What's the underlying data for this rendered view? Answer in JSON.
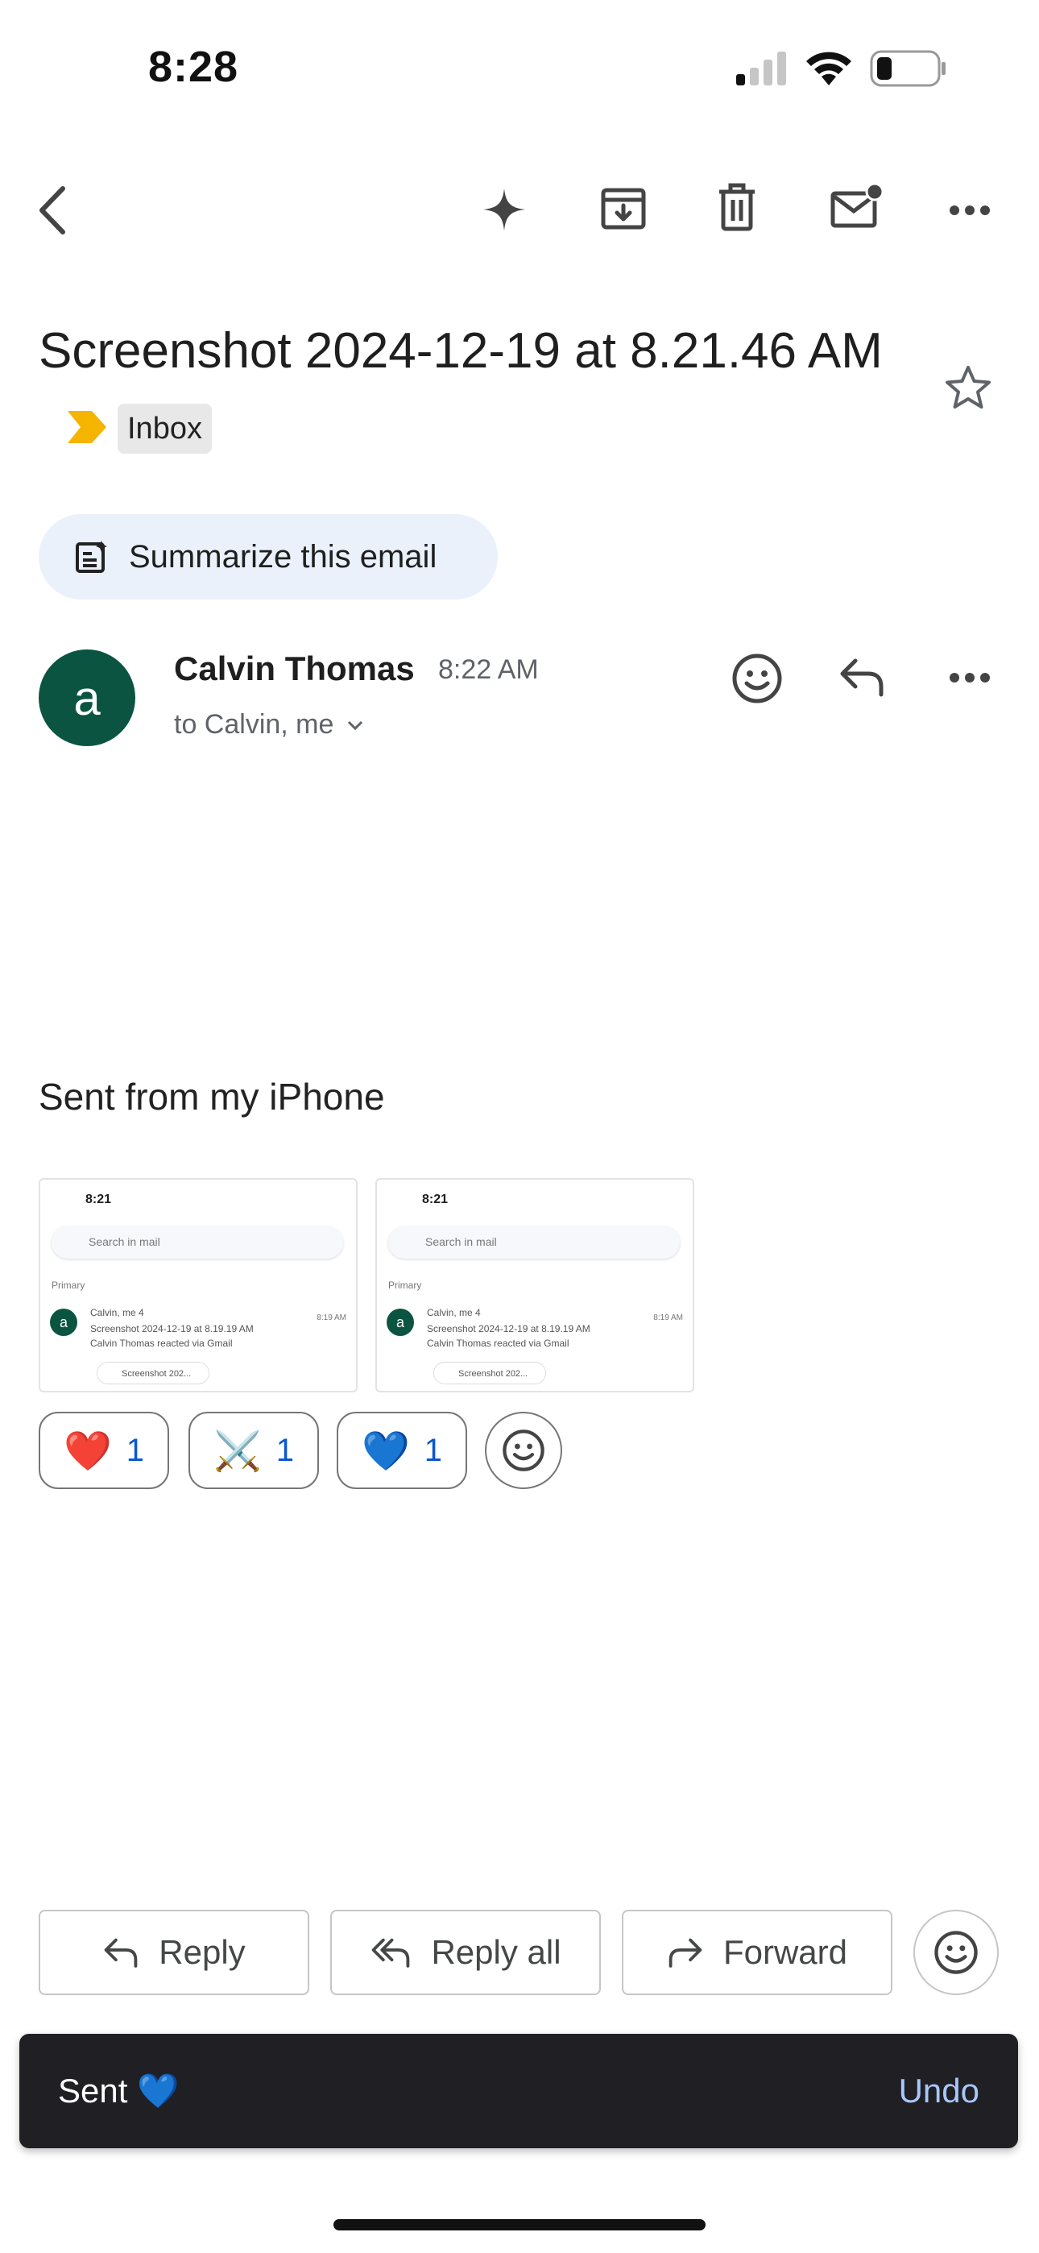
{
  "status_bar": {
    "time": "8:28"
  },
  "toolbar": {
    "icons": [
      "back-icon",
      "sparkle-icon",
      "archive-icon",
      "trash-icon",
      "mark-unread-icon",
      "more-icon"
    ]
  },
  "email": {
    "subject": "Screenshot 2024-12-19 at 8.21.46 AM",
    "label": "Inbox",
    "summarize_label": "Summarize this email",
    "sender": {
      "avatar_letter": "a",
      "name": "Calvin Thomas",
      "time": "8:22 AM",
      "recipients": "to Calvin, me"
    },
    "body": "Sent from my iPhone",
    "thumbnails": [
      {
        "time": "8:21",
        "search_placeholder": "Search in mail",
        "section": "Primary",
        "avatar_letter": "a",
        "from": "Calvin, me 4",
        "received": "8:19 AM",
        "subject": "Screenshot 2024-12-19 at 8.19.19 AM",
        "snippet": "Calvin Thomas reacted via Gmail",
        "attachment": "Screenshot 202..."
      },
      {
        "time": "8:21",
        "search_placeholder": "Search in mail",
        "section": "Primary",
        "avatar_letter": "a",
        "from": "Calvin, me 4",
        "received": "8:19 AM",
        "subject": "Screenshot 2024-12-19 at 8.19.19 AM",
        "snippet": "Calvin Thomas reacted via Gmail",
        "attachment": "Screenshot 202..."
      }
    ],
    "reactions": [
      {
        "emoji": "❤️",
        "count": "1"
      },
      {
        "emoji": "⚔️",
        "count": "1"
      },
      {
        "emoji": "💙",
        "count": "1"
      }
    ]
  },
  "actions": {
    "reply": "Reply",
    "reply_all": "Reply all",
    "forward": "Forward"
  },
  "snackbar": {
    "message": "Sent 💙",
    "undo": "Undo"
  },
  "colors": {
    "accent": "#0b57d0",
    "avatar": "#0b5441",
    "label_arrow": "#f5b400",
    "snackbar_bg": "#1f1f24",
    "undo": "#a8c7fa"
  }
}
